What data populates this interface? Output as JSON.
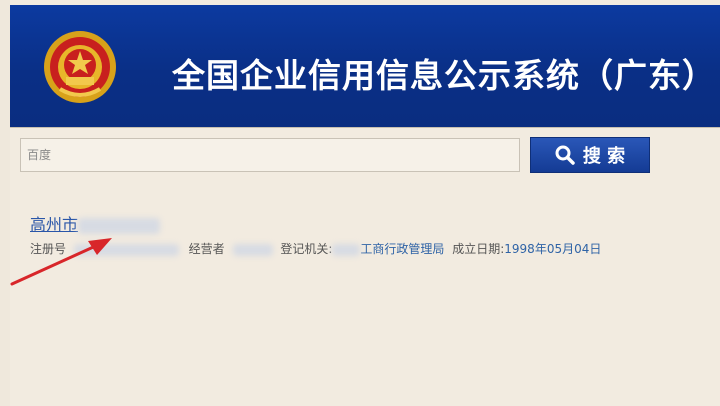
{
  "header": {
    "title": "全国企业信用信息公示系统（广东）",
    "emblem_icon": "national-emblem-icon",
    "colors": {
      "bar": "#0b3592",
      "title": "#ffffff"
    }
  },
  "search": {
    "placeholder": "百度",
    "button_label": "搜 索",
    "button_icon": "search-icon",
    "button_color": "#1a449e"
  },
  "result": {
    "title_visible": "高州市",
    "reg_no_label": "注册号",
    "operator_label": "经营者",
    "authority_label": "登记机关:",
    "authority_visible": "工商行政管理局",
    "founded_label": "成立日期:",
    "founded_value": "1998年05月04日",
    "link_color": "#2955a8"
  },
  "annotation": {
    "arrow_color": "#d8262a",
    "arrow_icon": "red-arrow-annotation"
  }
}
